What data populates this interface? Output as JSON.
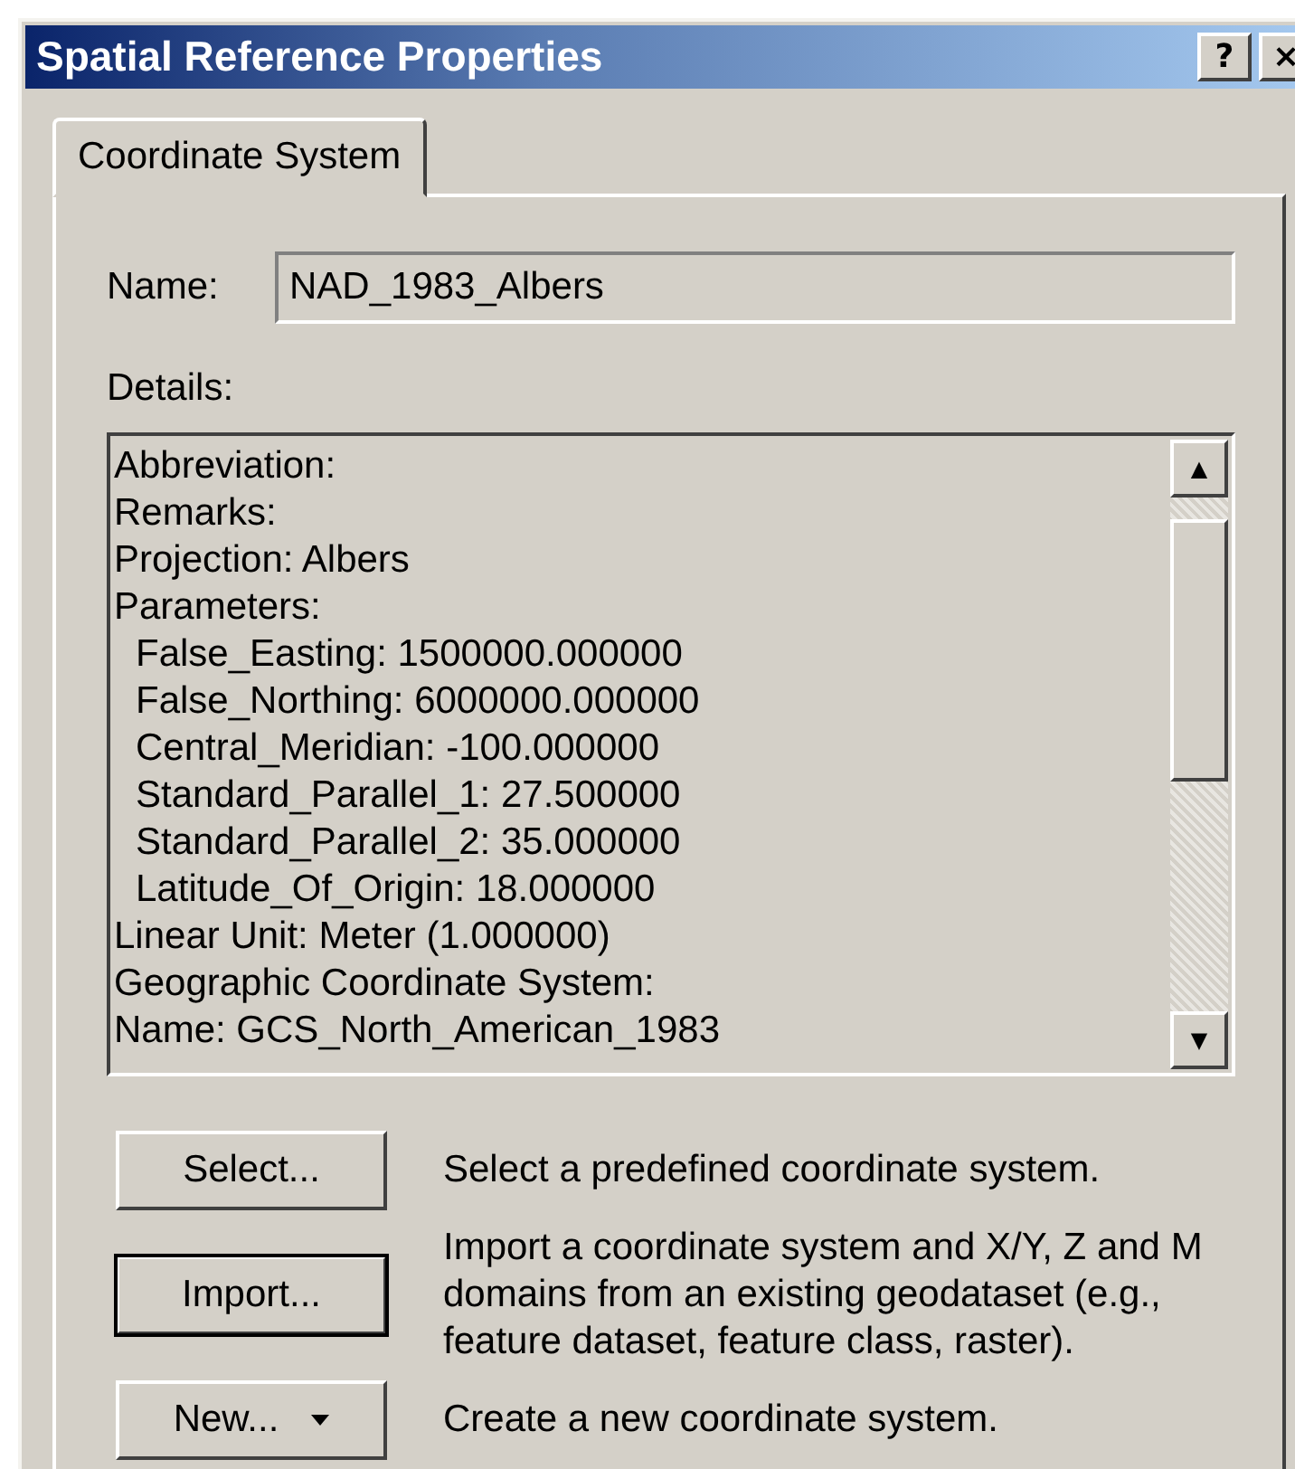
{
  "window": {
    "title": "Spatial Reference Properties",
    "title_buttons": [
      "?",
      "×"
    ]
  },
  "tabs": [
    {
      "label": "Coordinate System",
      "selected": true
    }
  ],
  "name_field": {
    "label": "Name:",
    "value": "NAD_1983_Albers"
  },
  "details": {
    "label": "Details:",
    "scroll_up": "▲",
    "scroll_down": "▼",
    "lines": [
      {
        "text": "Abbreviation:",
        "indented": false
      },
      {
        "text": "Remarks:",
        "indented": false
      },
      {
        "text": "Projection: Albers",
        "indented": false
      },
      {
        "text": "Parameters:",
        "indented": false
      },
      {
        "text": "False_Easting: 1500000.000000",
        "indented": true
      },
      {
        "text": "False_Northing: 6000000.000000",
        "indented": true
      },
      {
        "text": "Central_Meridian: -100.000000",
        "indented": true
      },
      {
        "text": "Standard_Parallel_1: 27.500000",
        "indented": true
      },
      {
        "text": "Standard_Parallel_2: 35.000000",
        "indented": true
      },
      {
        "text": "Latitude_Of_Origin: 18.000000",
        "indented": true
      },
      {
        "text": "Linear Unit: Meter (1.000000)",
        "indented": false
      },
      {
        "text": "Geographic Coordinate System:",
        "indented": false
      },
      {
        "text": "Name: GCS_North_American_1983",
        "indented": false
      }
    ]
  },
  "actions": [
    {
      "label": "Select...",
      "description": "Select a predefined coordinate system.",
      "default": false,
      "dropdown": false
    },
    {
      "label": "Import...",
      "description": "Import a coordinate system and X/Y, Z and M domains from an existing geodataset (e.g., feature dataset, feature class, raster).",
      "default": true,
      "dropdown": false
    },
    {
      "label": "New...",
      "description": "Create a new coordinate system.",
      "default": false,
      "dropdown": true
    }
  ]
}
